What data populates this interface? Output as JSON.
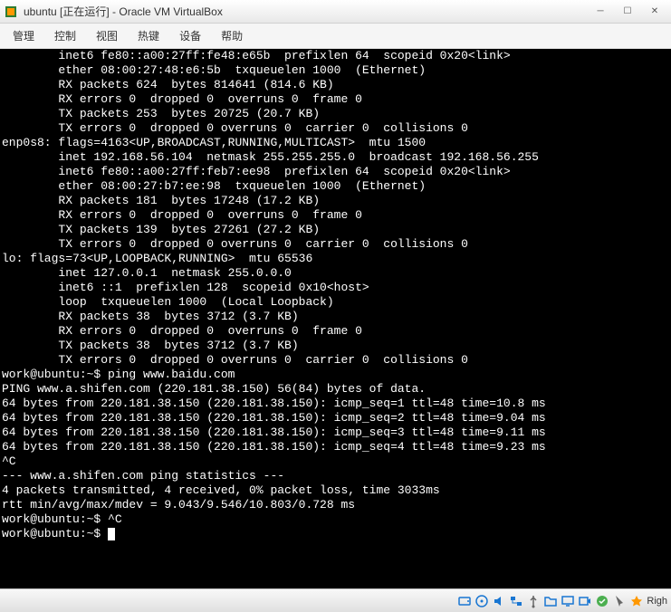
{
  "window": {
    "title": "ubuntu [正在运行] - Oracle VM VirtualBox"
  },
  "menu": {
    "items": [
      "管理",
      "控制",
      "视图",
      "热键",
      "设备",
      "帮助"
    ]
  },
  "terminal": {
    "lines": [
      "        inet6 fe80::a00:27ff:fe48:e65b  prefixlen 64  scopeid 0x20<link>",
      "        ether 08:00:27:48:e6:5b  txqueuelen 1000  (Ethernet)",
      "        RX packets 624  bytes 814641 (814.6 KB)",
      "        RX errors 0  dropped 0  overruns 0  frame 0",
      "        TX packets 253  bytes 20725 (20.7 KB)",
      "        TX errors 0  dropped 0 overruns 0  carrier 0  collisions 0",
      "",
      "enp0s8: flags=4163<UP,BROADCAST,RUNNING,MULTICAST>  mtu 1500",
      "        inet 192.168.56.104  netmask 255.255.255.0  broadcast 192.168.56.255",
      "        inet6 fe80::a00:27ff:feb7:ee98  prefixlen 64  scopeid 0x20<link>",
      "        ether 08:00:27:b7:ee:98  txqueuelen 1000  (Ethernet)",
      "        RX packets 181  bytes 17248 (17.2 KB)",
      "        RX errors 0  dropped 0  overruns 0  frame 0",
      "        TX packets 139  bytes 27261 (27.2 KB)",
      "        TX errors 0  dropped 0 overruns 0  carrier 0  collisions 0",
      "",
      "lo: flags=73<UP,LOOPBACK,RUNNING>  mtu 65536",
      "        inet 127.0.0.1  netmask 255.0.0.0",
      "        inet6 ::1  prefixlen 128  scopeid 0x10<host>",
      "        loop  txqueuelen 1000  (Local Loopback)",
      "        RX packets 38  bytes 3712 (3.7 KB)",
      "        RX errors 0  dropped 0  overruns 0  frame 0",
      "        TX packets 38  bytes 3712 (3.7 KB)",
      "        TX errors 0  dropped 0 overruns 0  carrier 0  collisions 0",
      "",
      "work@ubuntu:~$ ping www.baidu.com",
      "PING www.a.shifen.com (220.181.38.150) 56(84) bytes of data.",
      "64 bytes from 220.181.38.150 (220.181.38.150): icmp_seq=1 ttl=48 time=10.8 ms",
      "64 bytes from 220.181.38.150 (220.181.38.150): icmp_seq=2 ttl=48 time=9.04 ms",
      "64 bytes from 220.181.38.150 (220.181.38.150): icmp_seq=3 ttl=48 time=9.11 ms",
      "64 bytes from 220.181.38.150 (220.181.38.150): icmp_seq=4 ttl=48 time=9.23 ms",
      "^C",
      "--- www.a.shifen.com ping statistics ---",
      "4 packets transmitted, 4 received, 0% packet loss, time 3033ms",
      "rtt min/avg/max/mdev = 9.043/9.546/10.803/0.728 ms",
      "work@ubuntu:~$ ^C",
      "work@ubuntu:~$ "
    ],
    "prompt": "work@ubuntu:~$"
  },
  "statusbar": {
    "host_key": "Righ"
  }
}
